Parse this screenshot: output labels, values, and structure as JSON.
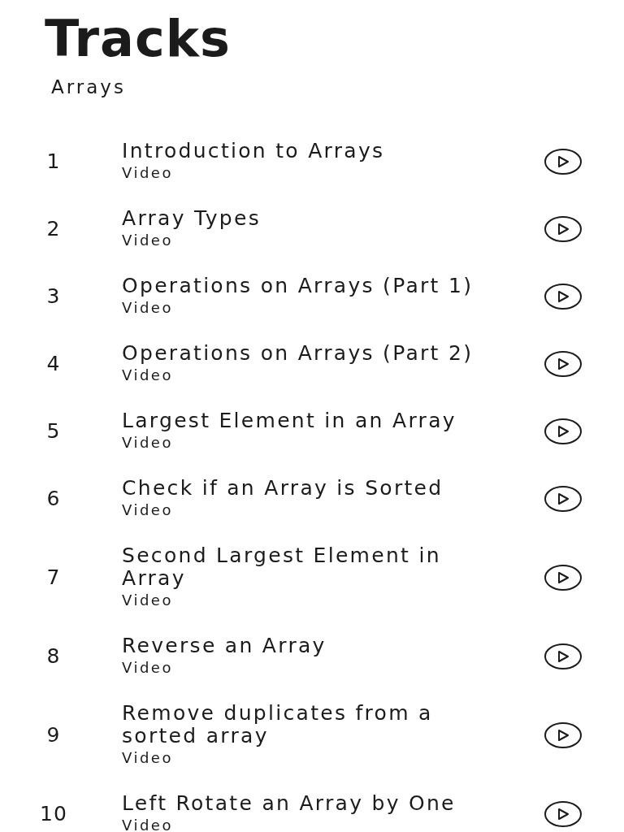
{
  "header": {
    "title": "Tracks",
    "subtitle": "Arrays"
  },
  "lessons": [
    {
      "number": "1",
      "title": "Introduction to Arrays",
      "type": "Video"
    },
    {
      "number": "2",
      "title": "Array Types",
      "type": "Video"
    },
    {
      "number": "3",
      "title": "Operations on Arrays (Part 1)",
      "type": "Video"
    },
    {
      "number": "4",
      "title": "Operations on Arrays (Part 2)",
      "type": "Video"
    },
    {
      "number": "5",
      "title": "Largest Element in an Array",
      "type": "Video"
    },
    {
      "number": "6",
      "title": "Check if an Array is Sorted",
      "type": "Video"
    },
    {
      "number": "7",
      "title": "Second Largest Element in Array",
      "type": "Video"
    },
    {
      "number": "8",
      "title": "Reverse an Array",
      "type": "Video"
    },
    {
      "number": "9",
      "title": "Remove duplicates from a sorted array",
      "type": "Video"
    },
    {
      "number": "10",
      "title": "Left Rotate an Array by One",
      "type": "Video"
    }
  ]
}
